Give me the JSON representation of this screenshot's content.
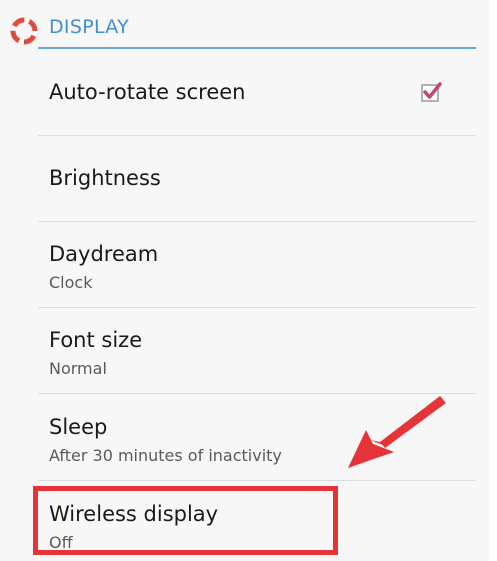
{
  "section": {
    "title": "DISPLAY",
    "icon": "settings-lifebuoy-icon"
  },
  "settings": [
    {
      "title": "Auto-rotate screen",
      "summary": "",
      "control": "checkbox",
      "checked": true
    },
    {
      "title": "Brightness",
      "summary": ""
    },
    {
      "title": "Daydream",
      "summary": "Clock"
    },
    {
      "title": "Font size",
      "summary": "Normal"
    },
    {
      "title": "Sleep",
      "summary": "After 30 minutes of inactivity"
    },
    {
      "title": "Wireless display",
      "summary": "Off"
    }
  ],
  "annotation": {
    "highlight_color": "#e5333a",
    "target": "Wireless display"
  },
  "colors": {
    "accent": "#3f8fd2",
    "checkbox_check": "#c2476a",
    "background": "#f7f7f7"
  }
}
